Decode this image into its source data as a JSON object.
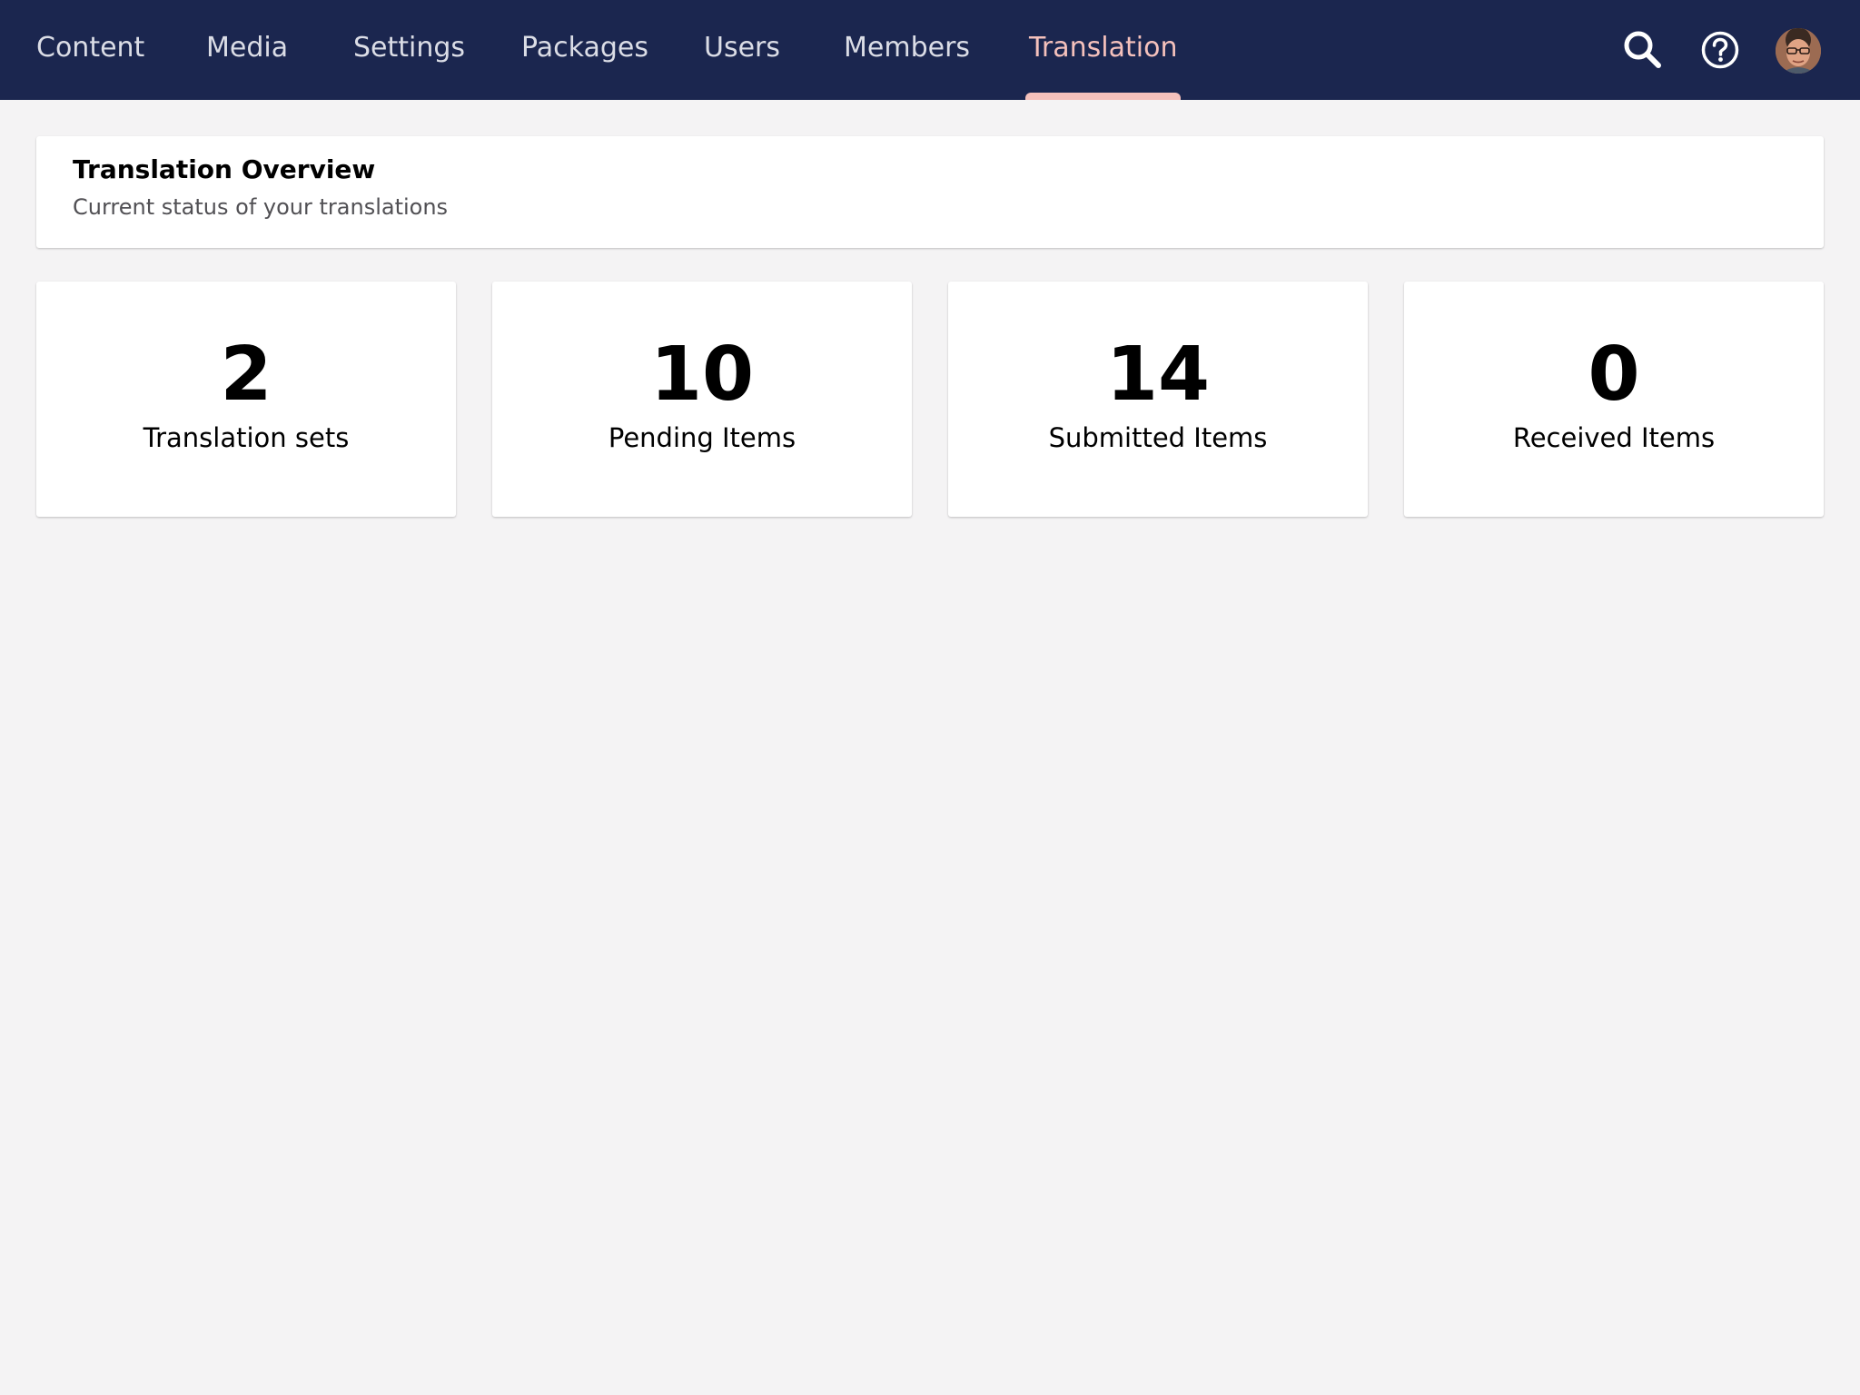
{
  "nav": {
    "items": [
      {
        "label": "Content"
      },
      {
        "label": "Media"
      },
      {
        "label": "Settings"
      },
      {
        "label": "Packages"
      },
      {
        "label": "Users"
      },
      {
        "label": "Members"
      },
      {
        "label": "Translation",
        "active": true
      }
    ],
    "active_color": "#f5c1bc"
  },
  "toolbar": {
    "icons": [
      "search-icon",
      "help-icon",
      "avatar"
    ]
  },
  "header": {
    "title": "Translation Overview",
    "subtitle": "Current status of your translations"
  },
  "stats": [
    {
      "value": "2",
      "label": "Translation sets"
    },
    {
      "value": "10",
      "label": "Pending Items"
    },
    {
      "value": "14",
      "label": "Submitted Items"
    },
    {
      "value": "0",
      "label": "Received Items"
    }
  ],
  "colors": {
    "topbar": "#1b264f",
    "background": "#f4f3f4",
    "nav_text": "#dbdde6",
    "accent": "#f5c1bc"
  }
}
